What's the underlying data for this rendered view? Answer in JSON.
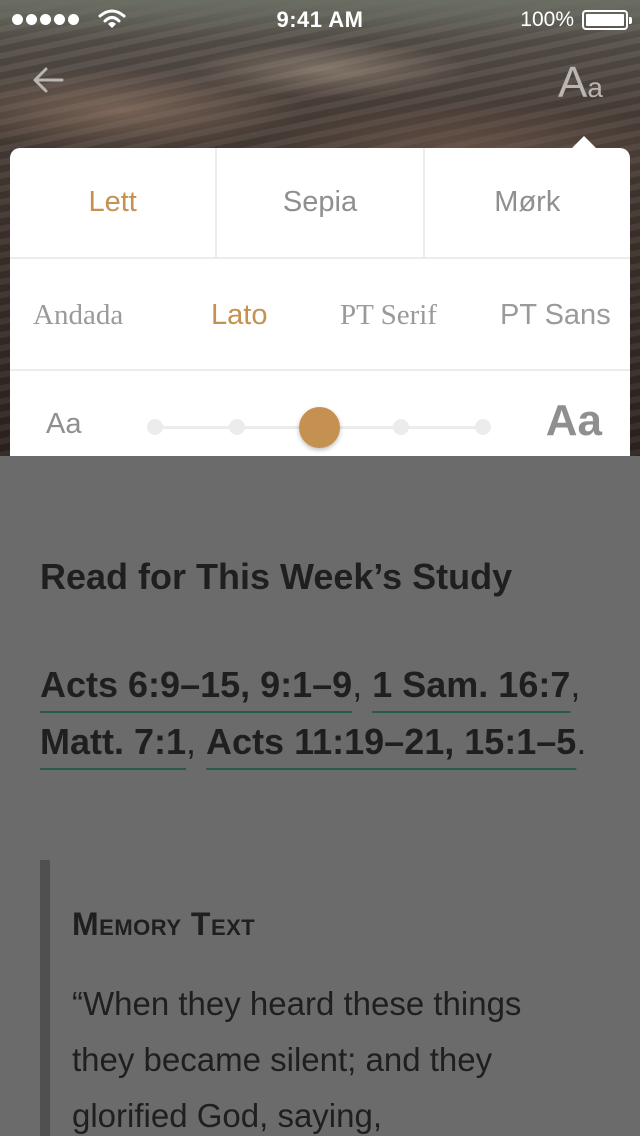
{
  "status_bar": {
    "time": "9:41 AM",
    "battery": "100%",
    "signal_icon": "signal-dots-icon",
    "wifi_icon": "wifi-icon"
  },
  "nav": {
    "back_icon": "back-arrow-icon",
    "font_toggle_big": "A",
    "font_toggle_small": "a"
  },
  "popover": {
    "themes": [
      "Lett",
      "Sepia",
      "Mørk"
    ],
    "active_theme": "Lett",
    "fonts": [
      "Andada",
      "Lato",
      "PT Serif",
      "PT Sans"
    ],
    "active_font": "Lato",
    "size_small_label": "Aa",
    "size_large_label": "Aa",
    "size_steps": 5,
    "size_selected_step": 3
  },
  "content": {
    "heading": "Read for This Week’s Study",
    "references": [
      {
        "text": "Acts 6:9–15, 9:1–9",
        "sep": ", "
      },
      {
        "text": "1 Sam. 16:7",
        "sep": ", "
      },
      {
        "text": "Matt. 7:1",
        "sep": ", "
      },
      {
        "text": "Acts 11:19–21, 15:1–5",
        "sep": "."
      }
    ],
    "memory_title": "Memory Text",
    "memory_text": "“When they heard these things they became silent; and they glorified God, saying,"
  },
  "colors": {
    "accent": "#c59150",
    "overlay": "#6b6b6b",
    "link_underline": "#2a5a4c"
  }
}
